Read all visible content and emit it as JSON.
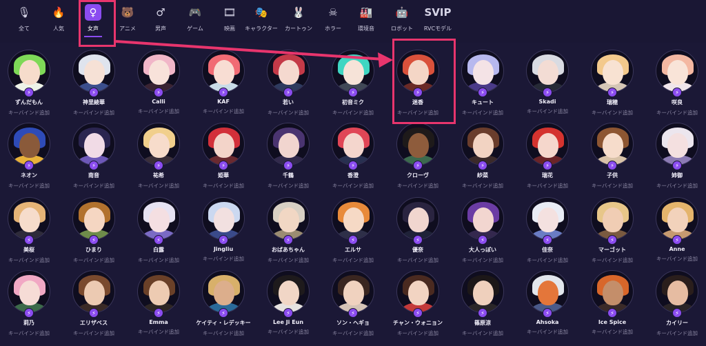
{
  "categories": [
    {
      "label": "全て",
      "icon": "microphone-icon",
      "glyph": "🎙",
      "active": false
    },
    {
      "label": "人気",
      "icon": "flame-icon",
      "glyph": "🔥",
      "active": false
    },
    {
      "label": "女声",
      "icon": "female-icon",
      "glyph": "♀",
      "active": true
    },
    {
      "label": "アニメ",
      "icon": "bear-icon",
      "glyph": "🐻",
      "active": false
    },
    {
      "label": "男声",
      "icon": "male-icon",
      "glyph": "♂",
      "active": false
    },
    {
      "label": "ゲーム",
      "icon": "gamepad-icon",
      "glyph": "🎮",
      "active": false
    },
    {
      "label": "映画",
      "icon": "film-reel-icon",
      "glyph": "🎞",
      "active": false
    },
    {
      "label": "キャラクター",
      "icon": "theater-masks-icon",
      "glyph": "🎭",
      "active": false
    },
    {
      "label": "カートゥン",
      "icon": "rabbit-icon",
      "glyph": "🐰",
      "active": false
    },
    {
      "label": "ホラー",
      "icon": "skull-icon",
      "glyph": "☠",
      "active": false
    },
    {
      "label": "環境音",
      "icon": "factory-icon",
      "glyph": "🏭",
      "active": false
    },
    {
      "label": "ロボット",
      "icon": "robot-icon",
      "glyph": "🤖",
      "active": false
    },
    {
      "label": "RVCモデル",
      "icon": "svip-icon",
      "glyph": "SVIP",
      "active": false
    }
  ],
  "keybind_label": "キーバインド追加",
  "badge_icon": "lightning-icon",
  "badge_glyph": "⚡",
  "highlight_color": "#e8356d",
  "accent_color": "#8b4cf0",
  "voices": [
    [
      {
        "name": "ずんだもん",
        "hair": "#7ed957",
        "skin": "#f6dccb",
        "cloth": "#eef3e8"
      },
      {
        "name": "神里綾華",
        "hair": "#dfe4ee",
        "skin": "#f6e1d6",
        "cloth": "#3b4e8c"
      },
      {
        "name": "Calli",
        "hair": "#f1b6c8",
        "skin": "#f8e2da",
        "cloth": "#3a2332"
      },
      {
        "name": "KAF",
        "hair": "#f16b74",
        "skin": "#f8ddd3",
        "cloth": "#c9dce8"
      },
      {
        "name": "若い",
        "hair": "#c43a48",
        "skin": "#f5d9cf",
        "cloth": "#2e3a5e"
      },
      {
        "name": "初音ミク",
        "hair": "#3fd6c2",
        "skin": "#f6e3d8",
        "cloth": "#404856"
      },
      {
        "name": "迷香",
        "hair": "#d9513b",
        "skin": "#f4d6c6",
        "cloth": "#6b2a26"
      },
      {
        "name": "キュート",
        "hair": "#b7b8ee",
        "skin": "#f4e3e6",
        "cloth": "#4a3a88"
      },
      {
        "name": "Skadi",
        "hair": "#d9dbe2",
        "skin": "#f3dcd4",
        "cloth": "#262a36"
      },
      {
        "name": "瑞穂",
        "hair": "#f3c98c",
        "skin": "#f8e2d2",
        "cloth": "#d5c6b5"
      },
      {
        "name": "咲良",
        "hair": "#f4b8a2",
        "skin": "#f9e4d8",
        "cloth": "#f0e5ea"
      }
    ],
    [
      {
        "name": "ネオン",
        "hair": "#2e4bb8",
        "skin": "#8a5a3a",
        "cloth": "#e8b23a"
      },
      {
        "name": "南音",
        "hair": "#2b2550",
        "skin": "#f1dbe6",
        "cloth": "#6d58b8"
      },
      {
        "name": "祐希",
        "hair": "#f1cf8c",
        "skin": "#f7dccb",
        "cloth": "#3a2f3a"
      },
      {
        "name": "姫華",
        "hair": "#d2303a",
        "skin": "#f3d4c9",
        "cloth": "#6a2a30"
      },
      {
        "name": "千鶴",
        "hair": "#4a3470",
        "skin": "#f1d5cf",
        "cloth": "#322a4c"
      },
      {
        "name": "香澄",
        "hair": "#e04656",
        "skin": "#f4d6cd",
        "cloth": "#283050"
      },
      {
        "name": "クローヴ",
        "hair": "#1e1a1a",
        "skin": "#8e5c3c",
        "cloth": "#3c6a4e"
      },
      {
        "name": "紗菜",
        "hair": "#6a3d2c",
        "skin": "#f2d3c2",
        "cloth": "#3b2a2a"
      },
      {
        "name": "瑞花",
        "hair": "#d4332f",
        "skin": "#f5d7cc",
        "cloth": "#6b2428"
      },
      {
        "name": "子供",
        "hair": "#8d5632",
        "skin": "#f6dccb",
        "cloth": "#d8c2a8"
      },
      {
        "name": "姉御",
        "hair": "#ece6ee",
        "skin": "#f4e0e0",
        "cloth": "#8c7bb4"
      }
    ],
    [
      {
        "name": "美桜",
        "hair": "#e6b477",
        "skin": "#f6dccb",
        "cloth": "#2e2b3a"
      },
      {
        "name": "ひまり",
        "hair": "#b2722e",
        "skin": "#f5d6c2",
        "cloth": "#6e8c4a"
      },
      {
        "name": "白露",
        "hair": "#e6e2f2",
        "skin": "#f4dfe2",
        "cloth": "#7a6ac4"
      },
      {
        "name": "Jingliu",
        "hair": "#cbd8f0",
        "skin": "#f2e0e0",
        "cloth": "#3a4a8a"
      },
      {
        "name": "おばあちゃん",
        "hair": "#d8d0c4",
        "skin": "#f1d7c4",
        "cloth": "#9b8c72"
      },
      {
        "name": "エルサ",
        "hair": "#e88a3a",
        "skin": "#f6d9c5",
        "cloth": "#2e2f48"
      },
      {
        "name": "優奈",
        "hair": "#2a2440",
        "skin": "#f1d6cf",
        "cloth": "#1f2238"
      },
      {
        "name": "大人っぽい",
        "hair": "#6b3ca4",
        "skin": "#f2d6d0",
        "cloth": "#34284e"
      },
      {
        "name": "佳奈",
        "hair": "#e9ecf5",
        "skin": "#f4e1e0",
        "cloth": "#6a7cc4"
      },
      {
        "name": "マーゴット",
        "hair": "#e7c689",
        "skin": "#f0cdb4",
        "cloth": "#7a5a40"
      },
      {
        "name": "Anne",
        "hair": "#e4b46c",
        "skin": "#f2d2bb",
        "cloth": "#c69a70"
      }
    ],
    [
      {
        "name": "莉乃",
        "hair": "#f1a8c4",
        "skin": "#f6dcd6",
        "cloth": "#3c6a4a"
      },
      {
        "name": "エリザベス",
        "hair": "#7a4a2e",
        "skin": "#eccab2",
        "cloth": "#3a2a26"
      },
      {
        "name": "Emma",
        "hair": "#6a4028",
        "skin": "#edcbb2",
        "cloth": "#2e2624"
      },
      {
        "name": "ケイティ・レデッキー",
        "hair": "#d8b06a",
        "skin": "#dcae8c",
        "cloth": "#2a6a9a"
      },
      {
        "name": "Lee Ji Eun",
        "hair": "#1e1a1c",
        "skin": "#f1d6c6",
        "cloth": "#e6e2e0"
      },
      {
        "name": "ソン・ヘギョ",
        "hair": "#3a2620",
        "skin": "#f0d2bf",
        "cloth": "#d6c4b6"
      },
      {
        "name": "チャン・ウォニョン",
        "hair": "#4a2a20",
        "skin": "#f2d4c2",
        "cloth": "#c43a3a"
      },
      {
        "name": "篠原涼",
        "hair": "#1c1718",
        "skin": "#efd0bd",
        "cloth": "#2a2628"
      },
      {
        "name": "Ahsoka",
        "hair": "#e2e6ec",
        "skin": "#e4763a",
        "cloth": "#4a5a8a"
      },
      {
        "name": "Ice Spice",
        "hair": "#d8662a",
        "skin": "#c48e6a",
        "cloth": "#3a2a28"
      },
      {
        "name": "カイリー",
        "hair": "#2a1e1c",
        "skin": "#e6bca2",
        "cloth": "#2a2426"
      }
    ]
  ]
}
